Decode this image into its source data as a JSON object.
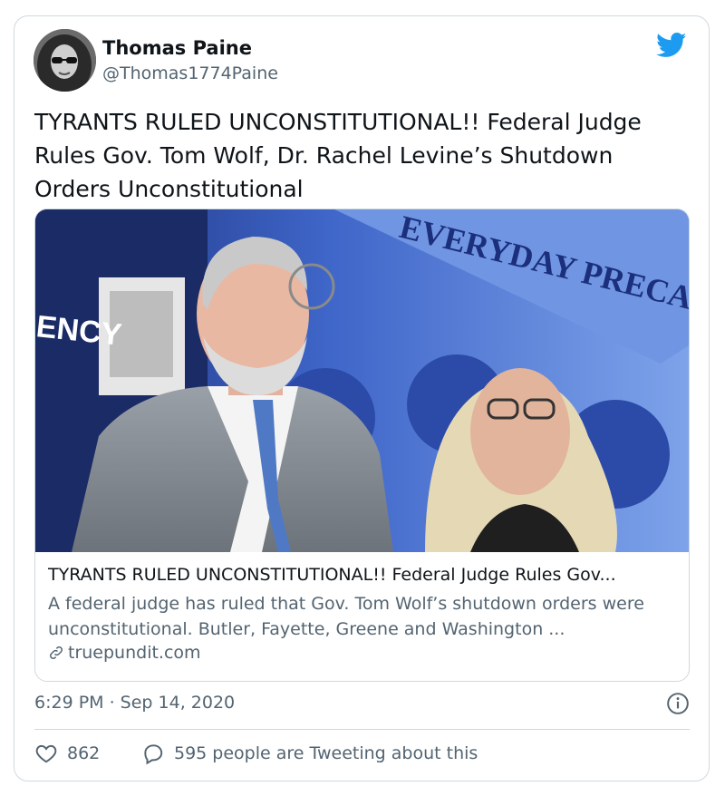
{
  "tweet": {
    "author_name": "Thomas Paine",
    "author_handle": "@Thomas1774Paine",
    "text": "TYRANTS RULED UNCONSTITUTIONAL!! Federal Judge Rules Gov. Tom Wolf, Dr. Rachel Levine’s Shutdown Orders Unconstitutional",
    "timestamp": "6:29 PM · Sep 14, 2020",
    "like_count": "862",
    "reply_text": "595 people are Tweeting about this"
  },
  "link_card": {
    "title": "TYRANTS RULED UNCONSTITUTIONAL!! Federal Judge Rules Gov...",
    "description": "A federal judge has ruled that Gov. Tom Wolf’s shutdown orders were unconstitutional. Butler, Fayette, Greene and Washington ...",
    "domain": "truepundit.com",
    "image_sign_left": "ENCY",
    "image_banner": "EVERYDAY PRECAUTIONS"
  },
  "icons": {
    "brand": "twitter-bird-icon",
    "link": "link-icon",
    "info": "info-icon",
    "like": "heart-icon",
    "reply": "speech-bubble-icon"
  },
  "colors": {
    "brand_blue": "#1d9bf0",
    "text_primary": "#0f1419",
    "text_secondary": "#536471",
    "border": "#cfd9de"
  }
}
